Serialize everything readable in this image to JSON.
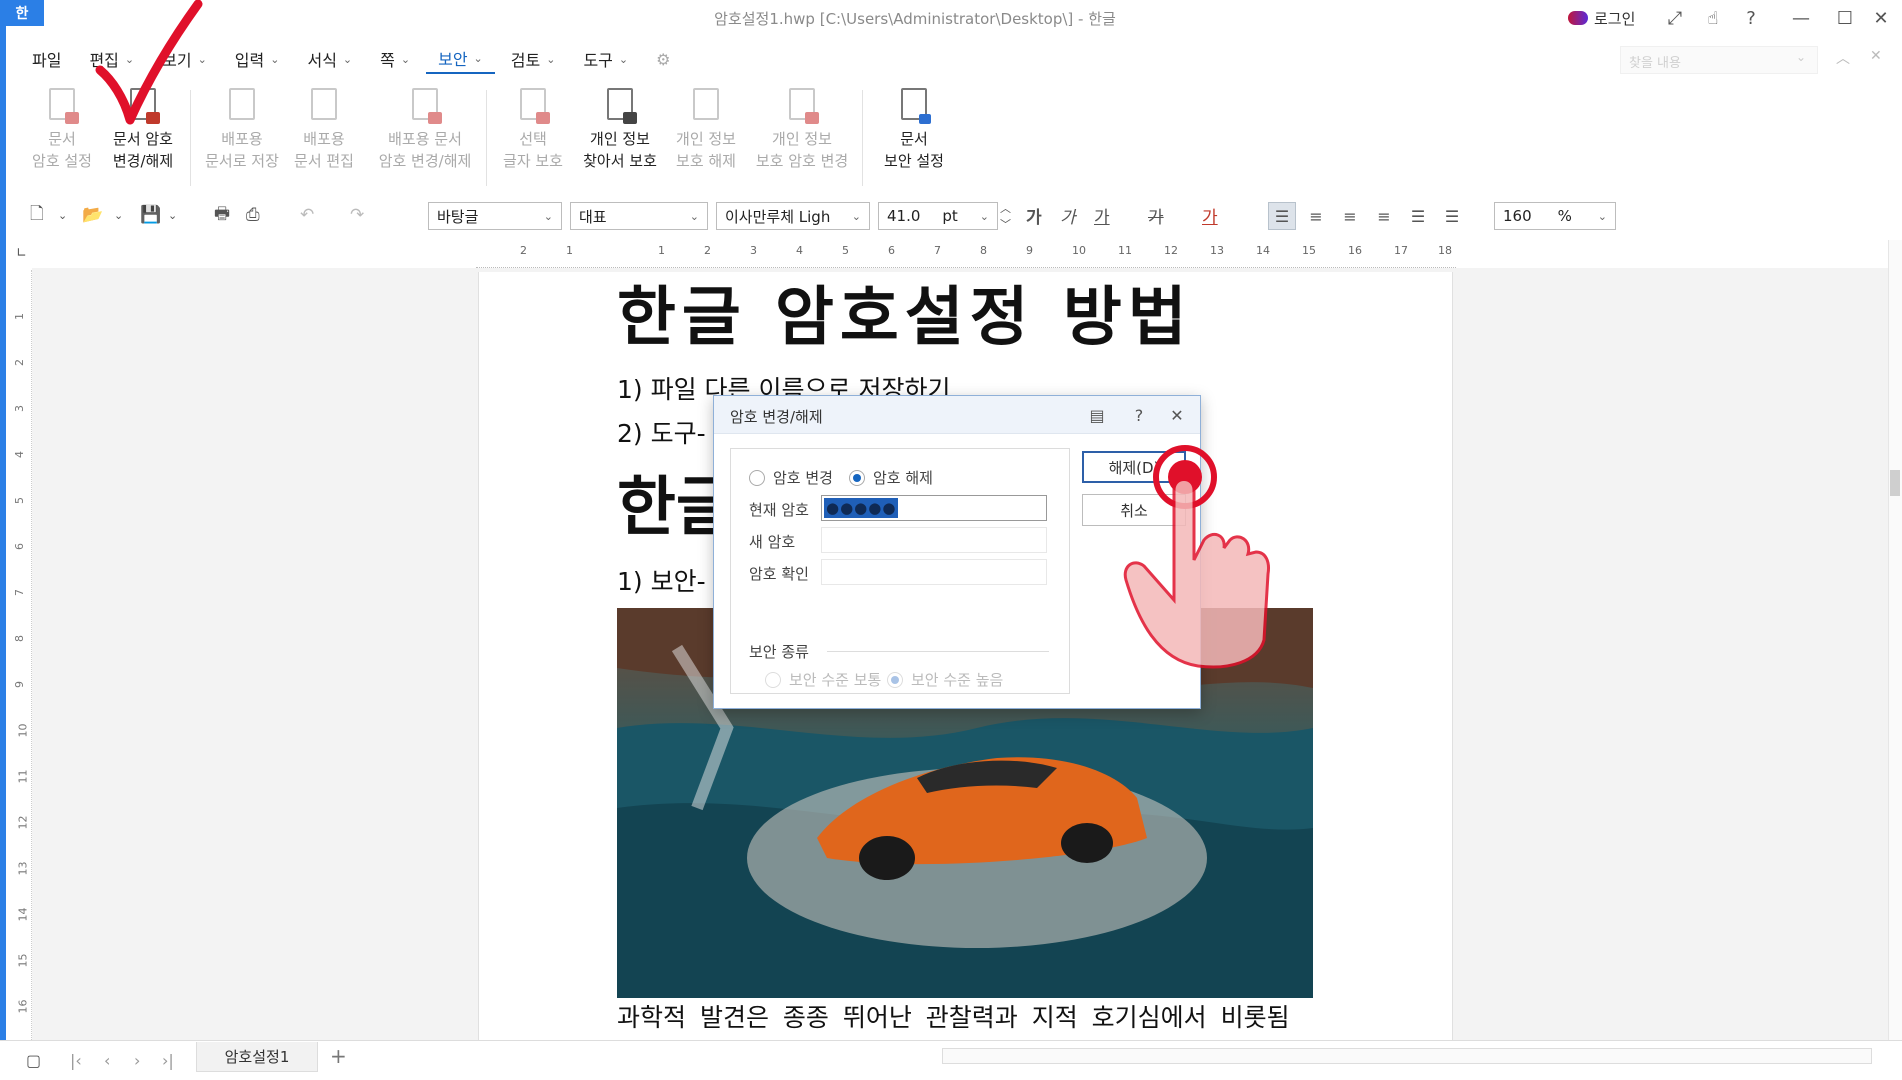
{
  "app": {
    "logo_text": "한",
    "window_title": "암호설정1.hwp [C:\\Users\\Administrator\\Desktop\\] - 한글",
    "login_label": "로그인"
  },
  "menu": {
    "items": [
      "파일",
      "편집",
      "보기",
      "입력",
      "서식",
      "쪽",
      "보안",
      "검토",
      "도구"
    ],
    "active": "보안",
    "search_placeholder": "찾을 내용"
  },
  "ribbon": {
    "buttons": [
      {
        "label1": "문서",
        "label2": "암호 설정",
        "enabled": false
      },
      {
        "label1": "문서 암호",
        "label2": "변경/해제",
        "enabled": true
      },
      {
        "label1": "배포용",
        "label2": "문서로 저장",
        "enabled": false
      },
      {
        "label1": "배포용",
        "label2": "문서 편집",
        "enabled": false
      },
      {
        "label1": "배포용 문서",
        "label2": "암호 변경/해제",
        "enabled": false
      },
      {
        "label1": "선택",
        "label2": "글자 보호",
        "enabled": false
      },
      {
        "label1": "개인 정보",
        "label2": "찾아서 보호",
        "enabled": true
      },
      {
        "label1": "개인 정보",
        "label2": "보호 해제",
        "enabled": false
      },
      {
        "label1": "개인 정보",
        "label2": "보호 암호 변경",
        "enabled": false
      },
      {
        "label1": "문서",
        "label2": "보안 설정",
        "enabled": true
      }
    ]
  },
  "toolbar": {
    "style": "바탕글",
    "language": "대표",
    "font": "이사만루체 Ligh",
    "font_size": "41.0",
    "size_unit": "pt",
    "zoom": "160",
    "zoom_unit": "%",
    "char_bold": "가",
    "char_italic": "가",
    "char_underline": "가",
    "char_strike": "가",
    "char_color": "가"
  },
  "ruler": {
    "h_ticks": [
      "2",
      "1",
      "1",
      "2",
      "3",
      "4",
      "5",
      "6",
      "7",
      "8",
      "9",
      "10",
      "11",
      "12",
      "13",
      "14",
      "15",
      "16",
      "17",
      "18"
    ],
    "v_ticks": [
      "1",
      "2",
      "3",
      "4",
      "5",
      "6",
      "7",
      "8",
      "9",
      "10",
      "11",
      "12",
      "13",
      "14",
      "15",
      "16"
    ]
  },
  "document": {
    "heading": "한글 암호설정 방법",
    "line1": "1) 파일 다른 이름으로 저장하기",
    "line2": "2) 도구-",
    "heading2": "한글",
    "line3": "1) 보안-",
    "caption": "과학적 발견은 종종 뛰어난 관찰력과 지적 호기심에서 비롯됨"
  },
  "dialog": {
    "title": "암호 변경/해제",
    "radio_change": "암호 변경",
    "radio_release": "암호 해제",
    "selected_mode": "암호 해제",
    "current_pw_label": "현재 암호",
    "current_pw_value": "●●●●●",
    "new_pw_label": "새 암호",
    "confirm_pw_label": "암호 확인",
    "sec_type_label": "보안 종류",
    "sec_normal": "보안 수준 보통",
    "sec_high": "보안 수준 높음",
    "ok_label": "해제(D)",
    "cancel_label": "취소"
  },
  "tabs": {
    "doc_tab": "암호설정1",
    "add": "+"
  },
  "colors": {
    "accent": "#2b7fe6",
    "active_menu": "#1565c0",
    "annotation_red": "#e0102a"
  }
}
